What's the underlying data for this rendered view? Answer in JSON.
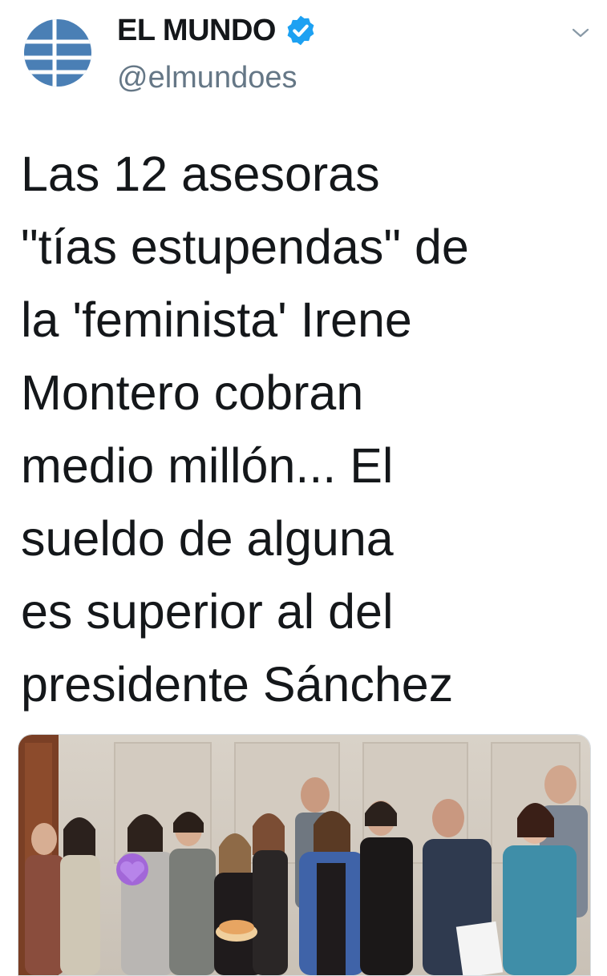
{
  "tweet": {
    "author": {
      "display_name": "EL MUNDO",
      "handle": "@elmundoes",
      "verified": true,
      "avatar_icon": "el-mundo-globe-logo",
      "avatar_color": "#4a7fb5"
    },
    "menu_icon": "chevron-down-icon",
    "text": "Las 12 asesoras\n\"tías estupendas\" de\nla 'feminista' Irene\nMontero cobran\nmedio millón... El\nsueldo de alguna\nes superior al del\npresidente Sánchez",
    "media": {
      "type": "photo",
      "emoji_overlay": "💜"
    }
  },
  "colors": {
    "verified_blue": "#1da1f2",
    "text": "#14171a",
    "secondary_text": "#657786"
  }
}
